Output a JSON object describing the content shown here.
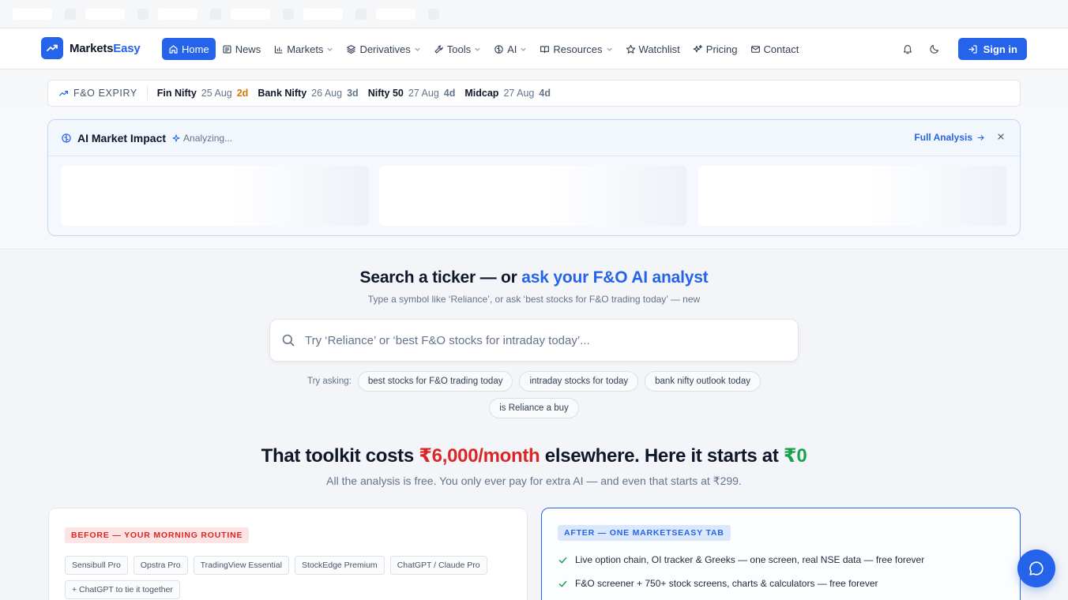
{
  "brand": {
    "name_prefix": "Markets",
    "name_accent": "Easy",
    "accent_color": "#2563eb"
  },
  "nav": {
    "items": [
      {
        "label": "Home",
        "icon": "home-icon",
        "active": true,
        "dropdown": false
      },
      {
        "label": "News",
        "icon": "newspaper-icon",
        "active": false,
        "dropdown": false
      },
      {
        "label": "Markets",
        "icon": "bar-chart-icon",
        "active": false,
        "dropdown": true
      },
      {
        "label": "Derivatives",
        "icon": "layers-icon",
        "active": false,
        "dropdown": true
      },
      {
        "label": "Tools",
        "icon": "wrench-icon",
        "active": false,
        "dropdown": true
      },
      {
        "label": "AI",
        "icon": "brain-icon",
        "active": false,
        "dropdown": true
      },
      {
        "label": "Resources",
        "icon": "book-icon",
        "active": false,
        "dropdown": true
      },
      {
        "label": "Watchlist",
        "icon": "star-icon",
        "active": false,
        "dropdown": false
      },
      {
        "label": "Pricing",
        "icon": "sparkles-icon",
        "active": false,
        "dropdown": false
      },
      {
        "label": "Contact",
        "icon": "mail-icon",
        "active": false,
        "dropdown": false
      }
    ],
    "signin_label": "Sign in"
  },
  "expiry": {
    "label": "F&O EXPIRY",
    "items": [
      {
        "name": "Fin Nifty",
        "date": "25 Aug",
        "days": "2d",
        "urgent": true
      },
      {
        "name": "Bank Nifty",
        "date": "26 Aug",
        "days": "3d",
        "urgent": false
      },
      {
        "name": "Nifty 50",
        "date": "27 Aug",
        "days": "4d",
        "urgent": false
      },
      {
        "name": "Midcap",
        "date": "27 Aug",
        "days": "4d",
        "urgent": false
      }
    ]
  },
  "ai_impact": {
    "title": "AI Market Impact",
    "status": "Analyzing...",
    "full_analysis": "Full Analysis"
  },
  "search": {
    "title_plain": "Search a ticker — or ",
    "title_accent": "ask your F&O AI analyst",
    "subtitle": "Type a symbol like ‘Reliance’, or ask ‘best stocks for F&O trading today’ — new",
    "placeholder": "Try ‘Reliance’ or ‘best F&O stocks for intraday today’...",
    "try_label": "Try asking:",
    "suggestions": [
      "best stocks for F&O trading today",
      "intraday stocks for today",
      "bank nifty outlook today",
      "is Reliance a buy"
    ]
  },
  "pricing": {
    "h_part1": "That toolkit costs ",
    "h_price": "₹6,000/month",
    "h_part2": " elsewhere. Here it starts at ",
    "h_free": "₹0",
    "subtitle": "All the analysis is free. You only ever pay for extra AI — and even that starts at ₹299."
  },
  "before": {
    "badge": "BEFORE — YOUR MORNING ROUTINE",
    "tools": [
      "Sensibull Pro",
      "Opstra Pro",
      "TradingView Essential",
      "StockEdge Premium",
      "ChatGPT / Claude Pro",
      "+ ChatGPT to tie it together"
    ]
  },
  "after": {
    "badge": "AFTER — ONE MARKETSEASY TAB",
    "points": [
      "Live option chain, OI tracker & Greeks — one screen, real NSE data — free forever",
      "F&O screener + 750+ stock screens, charts & calculators — free forever"
    ]
  }
}
